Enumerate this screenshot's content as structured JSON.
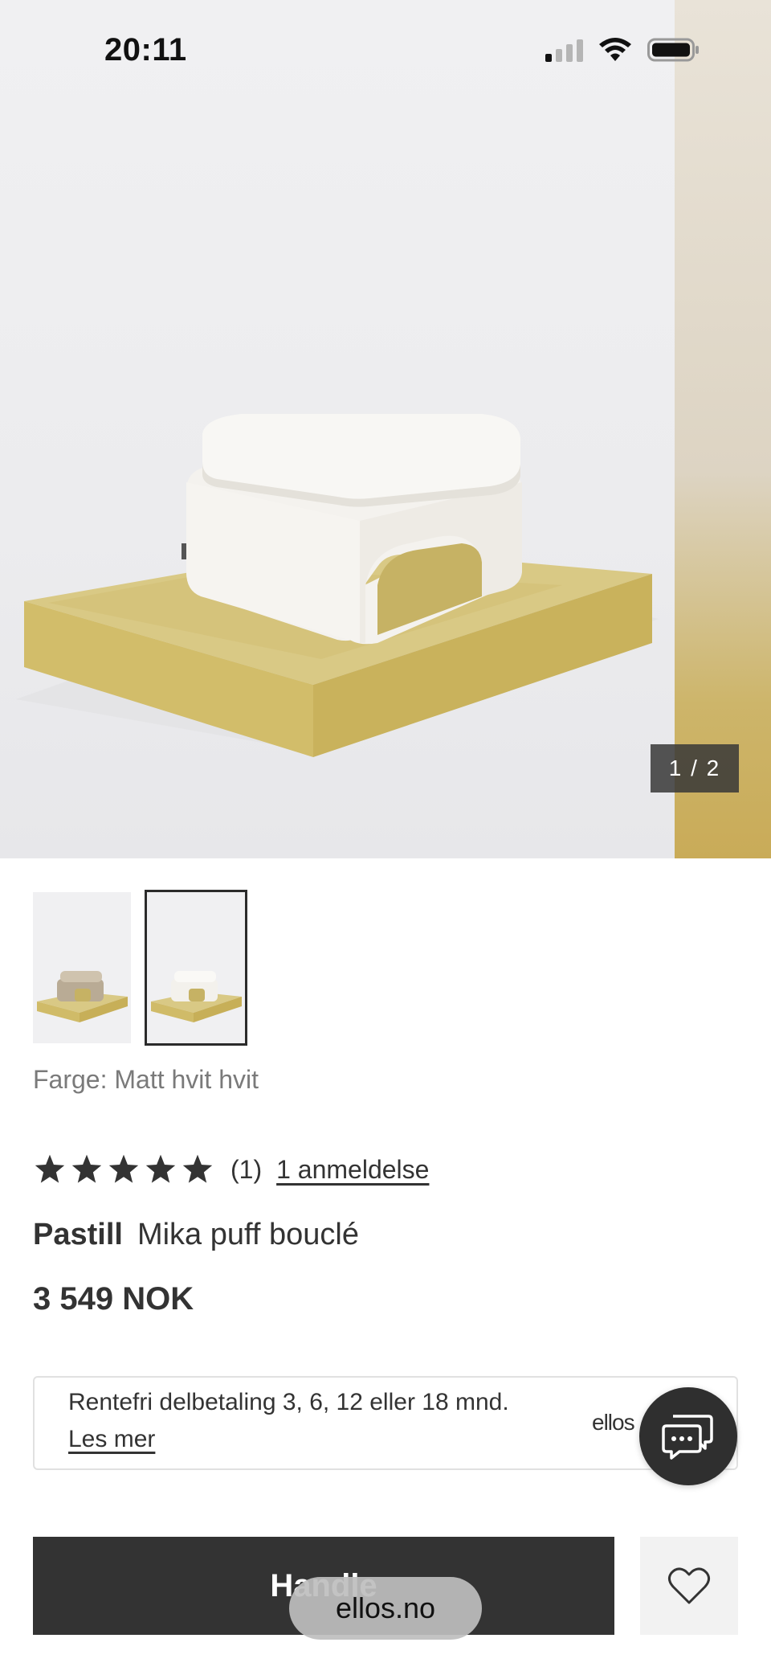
{
  "status_bar": {
    "time": "20:11",
    "icons": [
      "signal-icon",
      "wifi-icon",
      "battery-icon"
    ]
  },
  "gallery": {
    "counter": "1 / 2",
    "thumbnail_count": 2,
    "selected_index": 1
  },
  "product": {
    "color_line": "Farge: Matt hvit hvit",
    "rating_stars": 5,
    "rating_count": "(1)",
    "reviews_link": "1 anmeldelse",
    "brand": "Pastill",
    "name": "Mika puff bouclé",
    "price": "3 549 NOK"
  },
  "finance": {
    "text": "Rentefri delbetaling 3, 6, 12 eller 18 mnd.",
    "link": "Les mer",
    "logo": "ellos"
  },
  "actions": {
    "buy_label": "Handle",
    "favorite_icon": "heart-icon",
    "chat_icon": "chat-icon"
  },
  "browser": {
    "url": "ellos.no"
  },
  "colors": {
    "dark": "#333333",
    "mustard": "#d4c27a",
    "boucle": "#f3f0e8",
    "light_bg": "#f0f0f2"
  }
}
